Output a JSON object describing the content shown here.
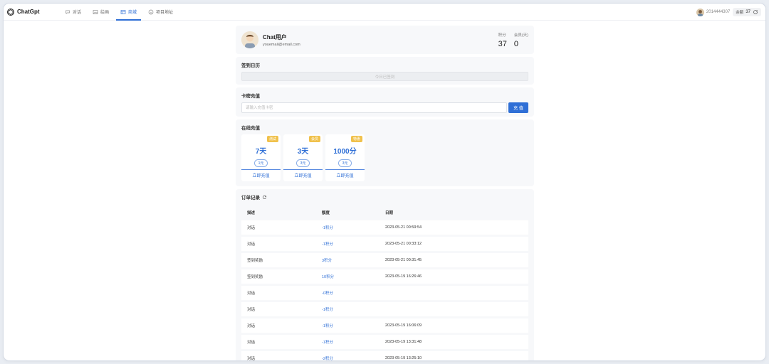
{
  "brand": {
    "name": "ChatGpt"
  },
  "nav": [
    {
      "label": "对话",
      "icon": "chat-icon",
      "active": false
    },
    {
      "label": "绘画",
      "icon": "image-icon",
      "active": false
    },
    {
      "label": "商城",
      "icon": "store-icon",
      "active": true
    },
    {
      "label": "项目地址",
      "icon": "github-icon",
      "active": false
    }
  ],
  "topbar": {
    "username": "2014444307",
    "balance_label": "余额",
    "balance_value": "37"
  },
  "profile": {
    "name": "Chat用户",
    "email": "youemail@email.com",
    "points_label": "积分",
    "points_value": "37",
    "vip_label": "会员(天)",
    "vip_value": "0"
  },
  "signin": {
    "title": "签到日历",
    "button_label": "今日已签到"
  },
  "card_recharge": {
    "title": "卡密充值",
    "placeholder": "请输入充值卡密",
    "button_label": "充 值"
  },
  "online": {
    "title": "在线充值",
    "packages": [
      {
        "badge": "测试",
        "name": "7天",
        "price": "1元",
        "buy_label": "立即充值"
      },
      {
        "badge": "会员",
        "name": "3天",
        "price": "3元",
        "buy_label": "立即充值"
      },
      {
        "badge": "特惠",
        "name": "1000分",
        "price": "3元",
        "buy_label": "立即充值"
      }
    ]
  },
  "orders": {
    "title": "订单记录",
    "columns": [
      "描述",
      "额度",
      "日期"
    ],
    "rows": [
      {
        "desc": "对话",
        "amount": "-1积分",
        "date": "2023-05-21 00:59:54"
      },
      {
        "desc": "对话",
        "amount": "-1积分",
        "date": "2023-05-21 00:33:12"
      },
      {
        "desc": "签到奖励",
        "amount": "3积分",
        "date": "2023-05-21 00:31:45"
      },
      {
        "desc": "签到奖励",
        "amount": "10积分",
        "date": "2023-05-19 16:26:46"
      },
      {
        "desc": "对话",
        "amount": "-0积分",
        "date": ""
      },
      {
        "desc": "对话",
        "amount": "-1积分",
        "date": ""
      },
      {
        "desc": "对话",
        "amount": "-1积分",
        "date": "2023-05-19 16:06:09"
      },
      {
        "desc": "对话",
        "amount": "-1积分",
        "date": "2023-05-19 13:31:48"
      },
      {
        "desc": "对话",
        "amount": "-2积分",
        "date": "2023-05-19 13:25:10"
      }
    ]
  },
  "colors": {
    "accent": "#2f6fd6",
    "badge": "#f0c14b",
    "card_bg": "#f7f8fa"
  }
}
